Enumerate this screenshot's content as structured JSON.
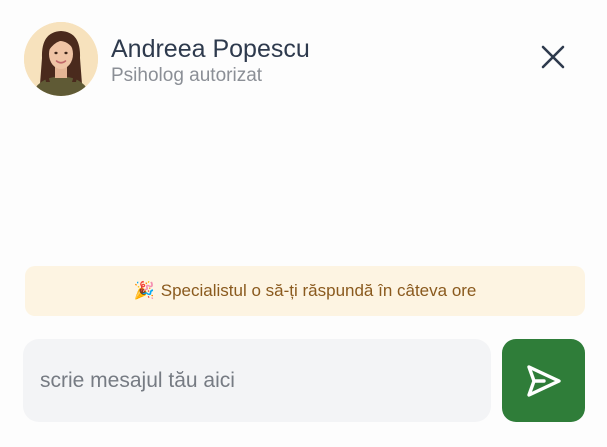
{
  "contact": {
    "name": "Andreea Popescu",
    "role": "Psiholog autorizat",
    "avatar_icon": "avatar-portrait"
  },
  "header": {
    "close_icon": "close-icon"
  },
  "notice": {
    "emoji": "🎉",
    "text": "Specialistul o să-ți răspundă în câteva ore"
  },
  "composer": {
    "placeholder": "scrie mesajul tău aici",
    "value": "",
    "send_icon": "send-icon"
  },
  "colors": {
    "accent": "#2f7d39",
    "notice_bg": "#fdf4e2",
    "notice_text": "#8a5a1e",
    "name_text": "#2e3a4d",
    "input_bg": "#f3f4f6"
  }
}
